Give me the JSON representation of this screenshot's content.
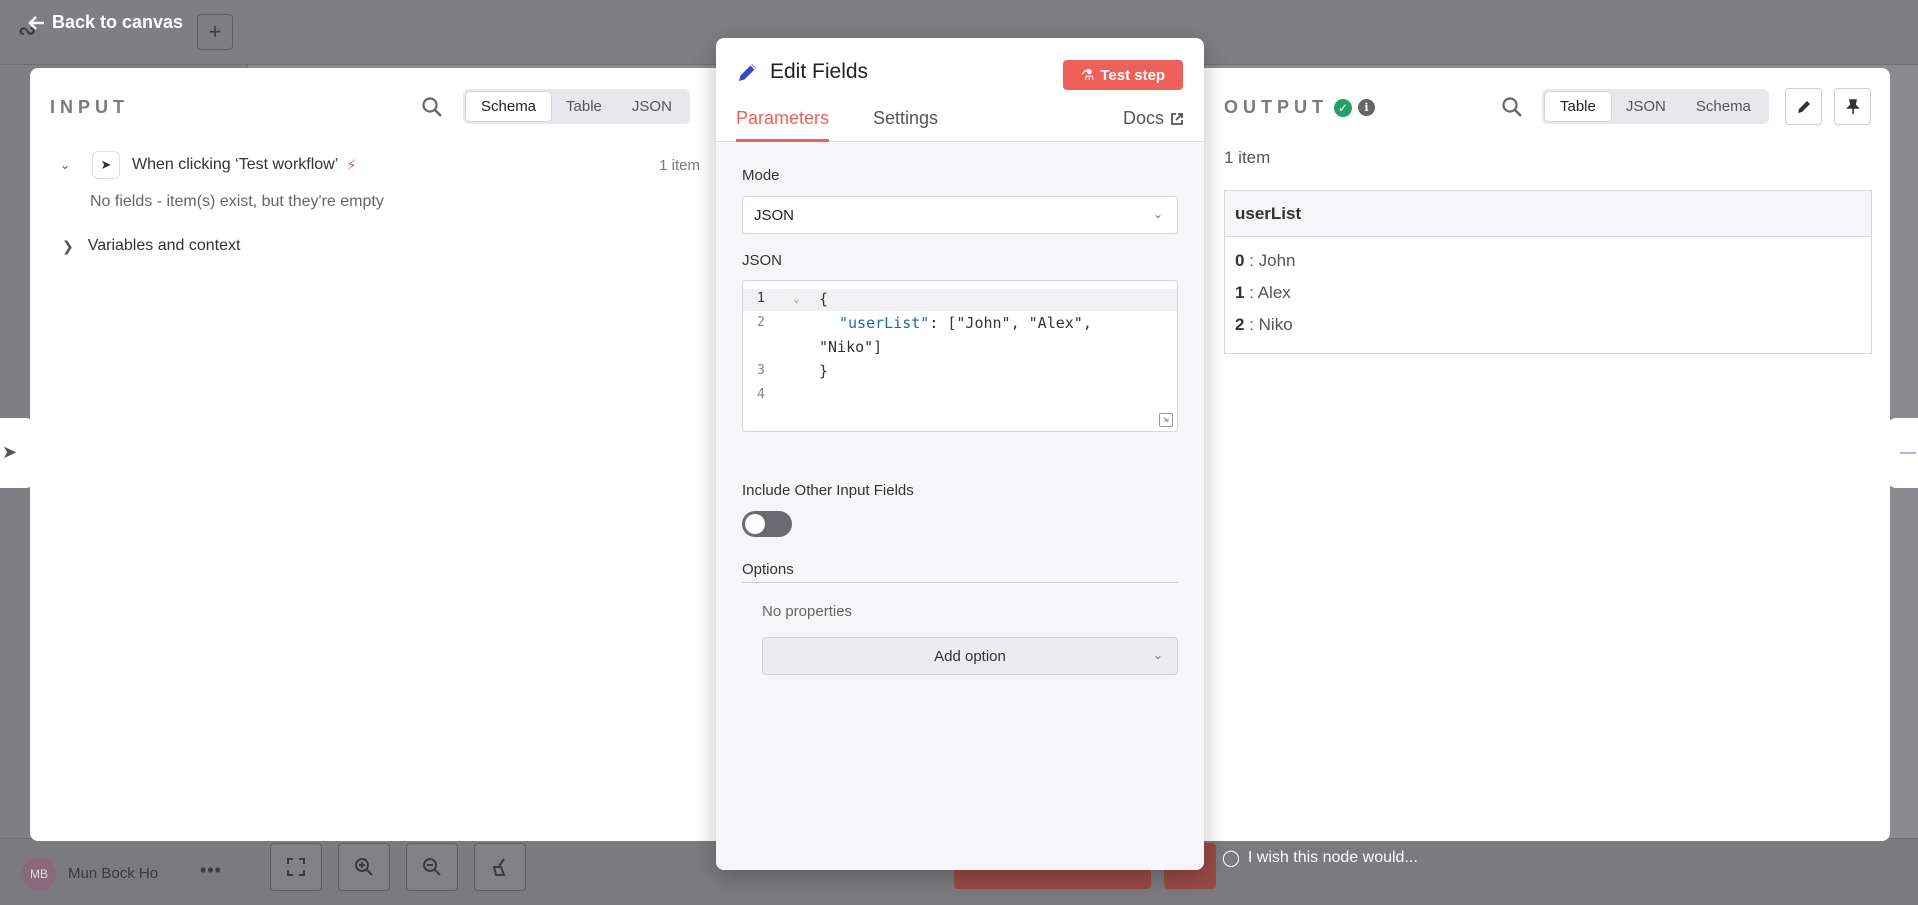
{
  "background": {
    "back_label": "Back to canvas",
    "user_initials": "MB",
    "user_name": "Mun Bock Ho",
    "wish_text": "I wish this node would..."
  },
  "input": {
    "title": "INPUT",
    "tabs": [
      "Schema",
      "Table",
      "JSON"
    ],
    "active_tab": "Schema",
    "node_label": "When clicking ‘Test workflow’",
    "node_count": "1 item",
    "empty_note": "No fields - item(s) exist, but they're empty",
    "vars_label": "Variables and context"
  },
  "edit": {
    "title": "Edit Fields",
    "test_button": "Test step",
    "tabs": [
      "Parameters",
      "Settings"
    ],
    "active_tab": "Parameters",
    "docs_label": "Docs",
    "mode_label": "Mode",
    "mode_value": "JSON",
    "json_label": "JSON",
    "code_lines": [
      {
        "n": "1",
        "text": "{"
      },
      {
        "n": "2",
        "key": "\"userList\"",
        "rest": ": [\"John\", \"Alex\",",
        "cont": "\"Niko\"]"
      },
      {
        "n": "3",
        "text": "}"
      },
      {
        "n": "4",
        "text": ""
      }
    ],
    "include_label": "Include Other Input Fields",
    "include_enabled": false,
    "options_label": "Options",
    "no_props": "No properties",
    "add_option": "Add option"
  },
  "output": {
    "title": "OUTPUT",
    "tabs": [
      "Table",
      "JSON",
      "Schema"
    ],
    "active_tab": "Table",
    "count": "1 item",
    "column": "userList",
    "rows": [
      {
        "index": "0",
        "value": "John"
      },
      {
        "index": "1",
        "value": "Alex"
      },
      {
        "index": "2",
        "value": "Niko"
      }
    ]
  },
  "colors": {
    "accent": "#f0605a",
    "success": "#25a06a",
    "json_key": "#1a6aa8",
    "overlay": "#8a8a8f"
  }
}
